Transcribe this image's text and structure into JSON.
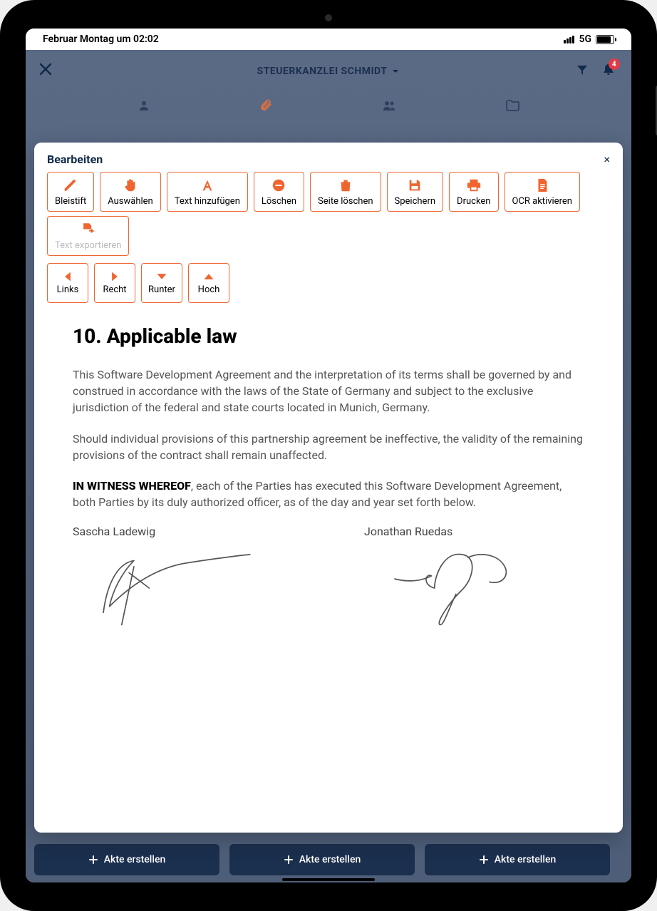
{
  "status": {
    "datetime": "Februar Montag um 02:02",
    "network": "5G"
  },
  "app": {
    "org_name": "STEUERKANZLEI SCHMIDT",
    "notification_count": "4",
    "create_button_label": "Akte erstellen"
  },
  "modal": {
    "title": "Bearbeiten",
    "close_label": "×"
  },
  "toolbar": {
    "pencil": "Bleistift",
    "select": "Auswählen",
    "add_text": "Text hinzufügen",
    "delete": "Löschen",
    "delete_page": "Seite löschen",
    "save": "Speichern",
    "print": "Drucken",
    "ocr": "OCR aktivieren",
    "export_text": "Text exportieren"
  },
  "nav": {
    "left": "Links",
    "right": "Recht",
    "down": "Runter",
    "up": "Hoch"
  },
  "document": {
    "heading": "10. Applicable law",
    "para1": "This Software Development Agreement and the interpretation of its terms shall be governed by and construed in accordance with the laws of the State of Germany and subject to the exclusive jurisdiction of the federal and state courts located in Munich, Germany.",
    "para2": "Should individual provisions of this partnership agreement be ineffective, the validity of the remaining provisions of the contract shall remain unaffected.",
    "witness_bold": "IN WITNESS WHEREOF",
    "witness_rest": ", each of the Parties has executed this Software Development Agreement, both Parties by its duly authorized officer, as of the day and year set forth below.",
    "signer1": "Sascha Ladewig",
    "signer2": "Jonathan Ruedas"
  }
}
